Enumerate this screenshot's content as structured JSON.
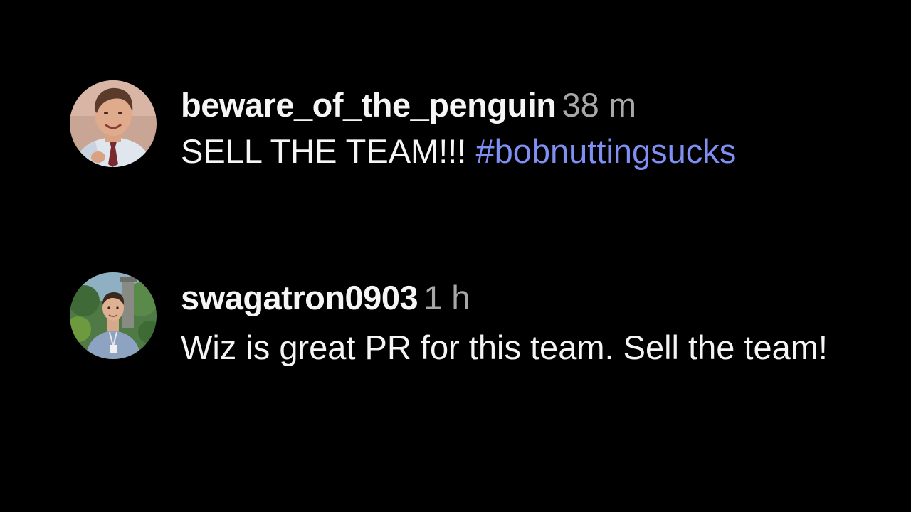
{
  "comments": [
    {
      "username": "beware_of_the_penguin",
      "time": "38 m",
      "text": "SELL THE TEAM!!!",
      "hashtag": "#bobnuttingsucks",
      "avatar_icon": "user-avatar-man-red-tie"
    },
    {
      "username": "swagatron0903",
      "time": "1 h",
      "text": "Wiz is great PR for this team. Sell the team!",
      "avatar_icon": "user-avatar-man-outdoors"
    }
  ],
  "colors": {
    "background": "#000000",
    "text": "#f5f5f5",
    "muted": "#a8a8a8",
    "hashtag": "#7f8ff4"
  }
}
